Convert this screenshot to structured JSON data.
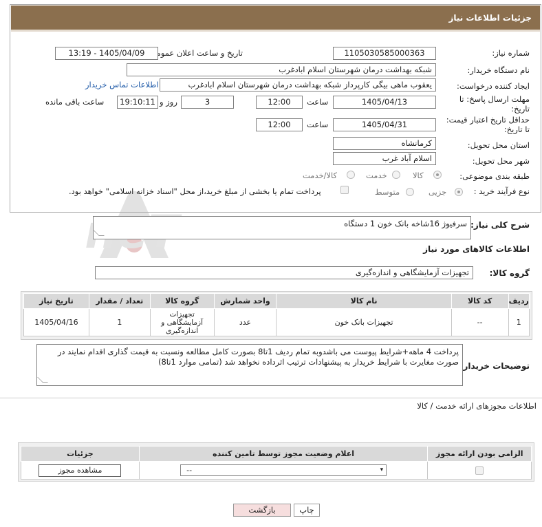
{
  "header": {
    "title": "جزئیات اطلاعات نیاز"
  },
  "fields": {
    "need_number_label": "شماره نیاز:",
    "need_number": "1105030585000363",
    "announce_label": "تاریخ و ساعت اعلان عمومی:",
    "announce_value": "1405/04/09 - 13:19",
    "buyer_org_label": "نام دستگاه خریدار:",
    "buyer_org": "شبکه بهداشت درمان شهرستان اسلام ابادغرب",
    "requester_label": "ایجاد کننده درخواست:",
    "requester": "یعقوب ماهی بیگی کارپرداز شبکه بهداشت درمان شهرستان اسلام ابادغرب",
    "contact_link": "اطلاعات تماس خریدار",
    "deadline_label_1": "مهلت ارسال پاسخ: تا",
    "deadline_label_2": "تاریخ:",
    "deadline_date": "1405/04/13",
    "time_label": "ساعت",
    "deadline_time": "12:00",
    "days_value": "3",
    "days_label": "روز و",
    "remaining_time": "19:10:11",
    "remaining_label": "ساعت باقی مانده",
    "validity_label_1": "حداقل تاریخ اعتبار قیمت:",
    "validity_label_2": "تا تاریخ:",
    "validity_date": "1405/04/31",
    "validity_time": "12:00",
    "province_label": "استان محل تحویل:",
    "province": "کرمانشاه",
    "city_label": "شهر محل تحویل:",
    "city": "اسلام آباد غرب",
    "category_label": "طبقه بندی موضوعی:",
    "category_options": [
      "کالا",
      "خدمت",
      "کالا/خدمت"
    ],
    "process_label": "نوع فرآیند خرید :",
    "process_options": [
      "جزیی",
      "متوسط"
    ],
    "payment_note": "پرداخت تمام یا بخشی از مبلغ خرید،از محل \"اسناد خزانه اسلامی\" خواهد بود."
  },
  "summary": {
    "label": "شرح کلی نیاز:",
    "value": "سرفیوژ 16شاخه بانک خون 1 دستگاه"
  },
  "goods_info_title": "اطلاعات کالاهای مورد نیاز",
  "goods_group": {
    "label": "گروه کالا:",
    "value": "تجهیزات آزمایشگاهی و اندازه‌گیری"
  },
  "goods_table": {
    "headers": [
      "ردیف",
      "کد کالا",
      "نام کالا",
      "واحد شمارش",
      "گروه کالا",
      "تعداد / مقدار",
      "تاریخ نیاز"
    ],
    "rows": [
      [
        "1",
        "--",
        "تجهیزات بانک خون",
        "عدد",
        "تجهیزات آزمایشگاهی و اندازه‌گیری",
        "1",
        "1405/04/16"
      ]
    ]
  },
  "buyer_notes": {
    "label": "توضیحات خریدار:",
    "value": "پرداخت 4 ماهه+شرایط پیوست می باشدوبه تمام ردیف 1تا8 بصورت کامل مطالعه ونسبت به قیمت گذاری اقدام نمایند در صورت مغایرت با شرایط خریدار به پیشنهادات ترتیب اثرداده نخواهد شد (تمامی موارد 1تا8)"
  },
  "permits": {
    "title": "اطلاعات مجوزهای ارائه خدمت / کالا",
    "headers": [
      "الزامی بودن ارائه مجوز",
      "اعلام وضعیت مجوز توسط تامین کننده",
      "جزئیات"
    ],
    "select_value": "--",
    "view_button": "مشاهده مجوز"
  },
  "buttons": {
    "print": "چاپ",
    "back": "بازگشت"
  },
  "watermark": "AriaTender.neT",
  "colors": {
    "header": "#8b6f4e",
    "link": "#1f5aa8",
    "back_button_bg": "#f6dede"
  }
}
